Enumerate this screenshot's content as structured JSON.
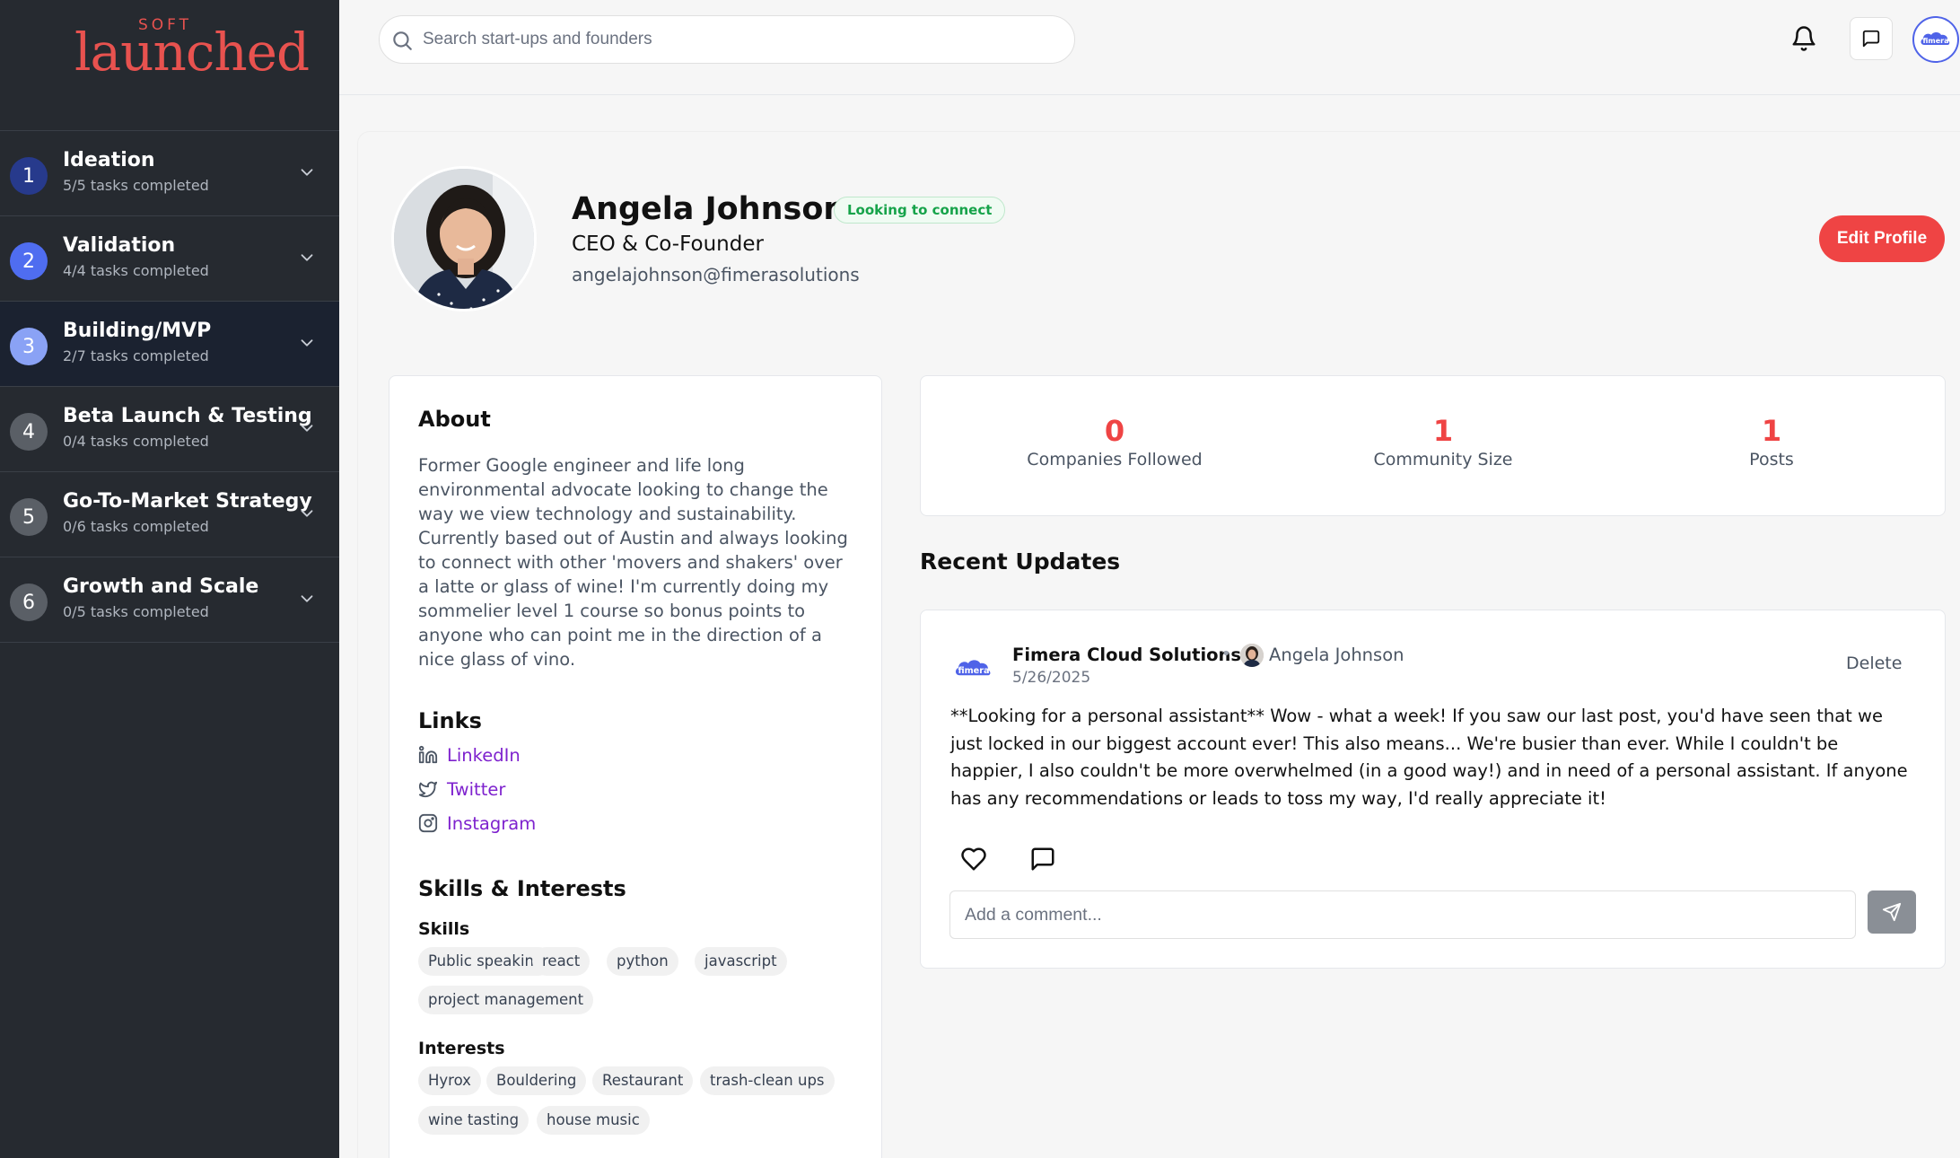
{
  "brand": {
    "small": "SOFT",
    "main": "launched",
    "color": "#e8524f"
  },
  "stages": [
    {
      "num": "1",
      "title": "Ideation",
      "sub": "5/5 tasks completed",
      "color": "#273a8c"
    },
    {
      "num": "2",
      "title": "Validation",
      "sub": "4/4 tasks completed",
      "color": "#4f6df0"
    },
    {
      "num": "3",
      "title": "Building/MVP",
      "sub": "2/7 tasks completed",
      "color": "#8aa2f5",
      "active": true
    },
    {
      "num": "4",
      "title": "Beta Launch & Testing",
      "sub": "0/4 tasks completed",
      "color": "#5a5f66"
    },
    {
      "num": "5",
      "title": "Go-To-Market Strategy",
      "sub": "0/6 tasks completed",
      "color": "#5a5f66"
    },
    {
      "num": "6",
      "title": "Growth and Scale",
      "sub": "0/5 tasks completed",
      "color": "#5a5f66"
    }
  ],
  "search": {
    "placeholder": "Search start-ups and founders"
  },
  "icons": {
    "search": "search-icon",
    "bell": "bell-icon",
    "messages": "message-square-icon",
    "avatar": "company-logo-icon"
  },
  "profile": {
    "name": "Angela Johnson",
    "badge": "Looking to connect",
    "role": "CEO & Co-Founder",
    "email": "angelajohnson@fimerasolutions",
    "edit_label": "Edit Profile"
  },
  "about": {
    "heading": "About",
    "text": "Former Google engineer and life long environmental advocate looking to change the way we view technology and sustainability. Currently based out of Austin and always looking to connect with other 'movers and shakers' over a latte or glass of wine! I'm currently doing my sommelier level 1 course so bonus points to anyone who can point me in the direction of a nice glass of vino."
  },
  "links": {
    "heading": "Links",
    "items": [
      {
        "label": "LinkedIn",
        "icon": "linkedin-icon"
      },
      {
        "label": "Twitter",
        "icon": "twitter-icon"
      },
      {
        "label": "Instagram",
        "icon": "instagram-icon"
      }
    ]
  },
  "skills_interests": {
    "heading": "Skills & Interests",
    "skills_label": "Skills",
    "skills": [
      "Public speaking",
      "react",
      "python",
      "javascript",
      "project management"
    ],
    "interests_label": "Interests",
    "interests": [
      "Hyrox",
      "Bouldering",
      "Restaurant",
      "trash-clean ups",
      "wine tasting",
      "house music"
    ]
  },
  "stats": [
    {
      "value": "0",
      "label": "Companies Followed"
    },
    {
      "value": "1",
      "label": "Community Size"
    },
    {
      "value": "1",
      "label": "Posts"
    }
  ],
  "recent": {
    "heading": "Recent Updates",
    "post": {
      "company": "Fimera Cloud Solutions",
      "author": "Angela Johnson",
      "date": "5/26/2025",
      "delete_label": "Delete",
      "body": "**Looking for a personal assistant** Wow - what a week! If you saw our last post, you'd have seen that we just locked in our biggest account ever! This also means... We're busier than ever. While I couldn't be happier, I also couldn't be more overwhelmed (in a good way!) and in need of a personal assistant. If anyone has any recommendations or leads to toss my way, I'd really appreciate it!",
      "comment_placeholder": "Add a comment..."
    }
  }
}
